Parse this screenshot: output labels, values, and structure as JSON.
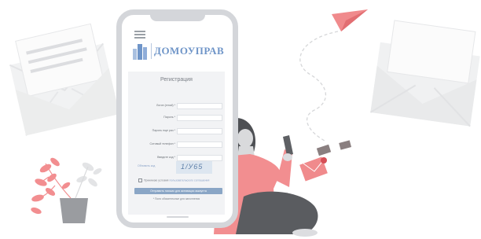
{
  "brand": {
    "name": "ДОМОУПРАВ"
  },
  "form": {
    "title": "Регистрация",
    "fields": [
      {
        "label": "Логин (email) *"
      },
      {
        "label": "Пароль *"
      },
      {
        "label": "Пароль еще раз *"
      },
      {
        "label": "Сотовый телефон *"
      },
      {
        "label": "Введите код *"
      }
    ],
    "captcha_refresh": "Обновить код",
    "captcha_code": "1/У65",
    "terms_prefix": "Принимаю условия",
    "terms_link": "пользовательского соглашения",
    "submit_label": "Отправить письмо для активации аккаунта",
    "required_note": "* Поля обязательные для заполнения"
  },
  "colors": {
    "brand_blue": "#6f95c8",
    "accent_pink": "#f0787c",
    "phone_frame": "#d4d6da",
    "button": "#8aa6c6"
  }
}
